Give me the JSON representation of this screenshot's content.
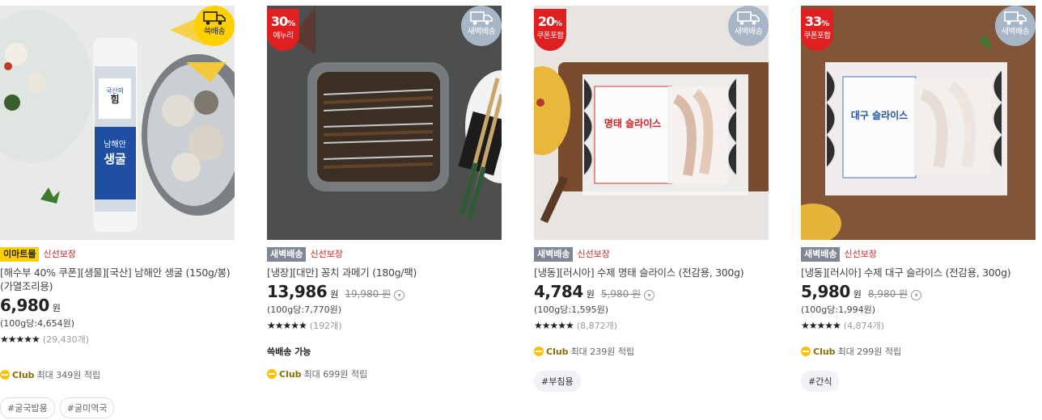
{
  "products": [
    {
      "discount": null,
      "delivery_badge": "쓱배송",
      "badges": [
        "이마트몰",
        "신선보장"
      ],
      "name": "[해수부 40% 쿠폰][생물][국산] 남해안 생굴 (150g/봉) (가열조리용)",
      "price": "6,980",
      "currency": "원",
      "original_price": "",
      "unit_price": "(100g당:4,654원)",
      "review_count": "(29,430개)",
      "rating": 5,
      "ssg_text": "",
      "club_label": "Club",
      "club_text": "최대 349원 적립",
      "tags": [
        "#굴국밥용",
        "#굴미역국"
      ],
      "package_text": [
        "국산의",
        "힘",
        "남해안",
        "생굴"
      ]
    },
    {
      "discount": {
        "pct": "30",
        "suffix": "%",
        "label": "에누리"
      },
      "delivery_badge": "새벽배송",
      "badges": [
        "새벽배송",
        "신선보장"
      ],
      "name": "[냉장][대만] 꽁치 과메기 (180g/팩)",
      "price": "13,986",
      "currency": "원",
      "original_price": "19,980 원",
      "unit_price": "(100g당:7,770원)",
      "review_count": "(192개)",
      "rating": 5,
      "ssg_text": "쓱배송 가능",
      "club_label": "Club",
      "club_text": "최대 699원 적립",
      "tags": []
    },
    {
      "discount": {
        "pct": "20",
        "suffix": "%",
        "label": "쿠폰포함"
      },
      "delivery_badge": "새벽배송",
      "badges": [
        "새벽배송",
        "신선보장"
      ],
      "name": "[냉동][러시아] 수제 명태 슬라이스 (전감용, 300g)",
      "price": "4,784",
      "currency": "원",
      "original_price": "5,980 원",
      "unit_price": "(100g당:1,595원)",
      "review_count": "(8,872개)",
      "rating": 5,
      "ssg_text": "",
      "club_label": "Club",
      "club_text": "최대 239원 적립",
      "tags": [
        "#부침용"
      ],
      "package_text": [
        "명태 슬라이스"
      ]
    },
    {
      "discount": {
        "pct": "33",
        "suffix": "%",
        "label": "쿠폰포함"
      },
      "delivery_badge": "새벽배송",
      "badges": [
        "새벽배송",
        "신선보장"
      ],
      "name": "[냉동][러시아] 수제 대구 슬라이스 (전감용, 300g)",
      "price": "5,980",
      "currency": "원",
      "original_price": "8,980 원",
      "unit_price": "(100g당:1,994원)",
      "review_count": "(4,874개)",
      "rating": 5,
      "ssg_text": "",
      "club_label": "Club",
      "club_text": "최대 299원 적립",
      "tags": [
        "#간식"
      ],
      "package_text": [
        "대구 슬라이스"
      ]
    }
  ],
  "colors": {
    "discount_red": "#e02020",
    "dawn_gray": "#7e8796",
    "emart_yellow": "#ffd000"
  },
  "icons": {
    "stars": "star-icon",
    "club": "club-coin-icon",
    "truck": "truck-icon",
    "info": "info-icon"
  }
}
